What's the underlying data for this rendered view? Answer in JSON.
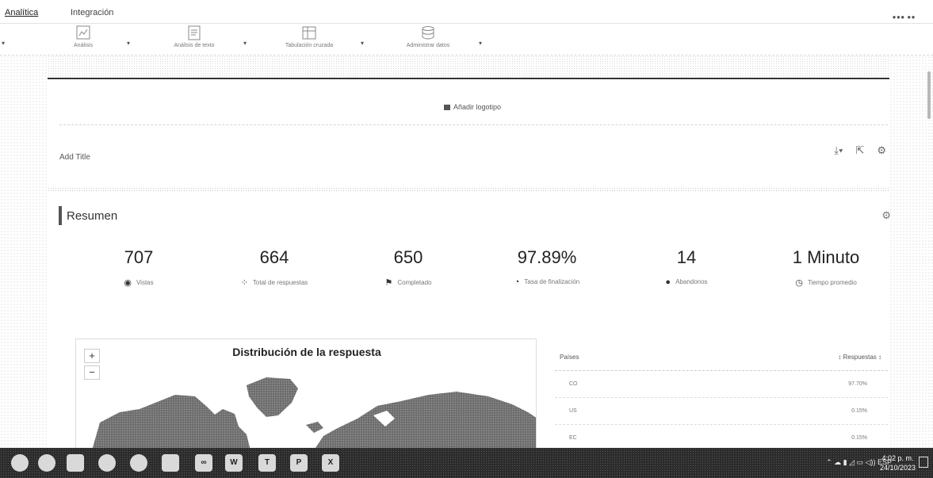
{
  "tabs": [
    {
      "label": "Analítica",
      "active": true
    },
    {
      "label": "Integración",
      "active": false
    }
  ],
  "toolbar": {
    "tools": [
      {
        "label": "Análisis",
        "icon": "chart-icon"
      },
      {
        "label": "Análisis de texto",
        "icon": "document-icon"
      },
      {
        "label": "Tabulación cruzada",
        "icon": "table-icon"
      },
      {
        "label": "Administrar datos",
        "icon": "database-icon"
      }
    ]
  },
  "report": {
    "add_logo": "Añadir logotipo",
    "add_title": "Add Title"
  },
  "resumen": {
    "title": "Resumen",
    "stats": [
      {
        "value": "707",
        "label": "Vistas",
        "icon": "eye-icon"
      },
      {
        "value": "664",
        "label": "Total de respuestas",
        "icon": "grid-icon"
      },
      {
        "value": "650",
        "label": "Completado",
        "icon": "flag-icon"
      },
      {
        "value": "97.89%",
        "label": "Tasa de finalización",
        "icon": "pie-icon"
      },
      {
        "value": "14",
        "label": "Abandonos",
        "icon": "door-icon"
      },
      {
        "value": "1 Minuto",
        "label": "Tiempo promedio",
        "icon": "clock-icon"
      }
    ]
  },
  "map": {
    "title": "Distribución de la respuesta",
    "zoom_in": "+",
    "zoom_out": "−"
  },
  "table": {
    "col_paises": "Países",
    "col_respuestas": "Respuestas",
    "rows": [
      {
        "pais": "CO",
        "pct": "97.70%"
      },
      {
        "pais": "US",
        "pct": "0.15%"
      },
      {
        "pais": "EC",
        "pct": "0.15%"
      }
    ]
  },
  "taskbar": {
    "lang": "ESP",
    "time": "4:02 p. m.",
    "date": "24/10/2023"
  }
}
